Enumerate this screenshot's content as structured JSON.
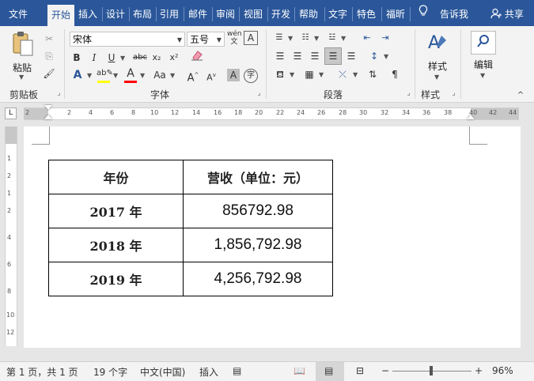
{
  "ribbon_tabs": [
    "文件",
    "开始",
    "插入",
    "设计",
    "布局",
    "引用",
    "邮件",
    "审阅",
    "视图",
    "开发",
    "帮助",
    "文字",
    "特色",
    "福昕",
    "告诉我",
    "共享"
  ],
  "active_tab": "开始",
  "font": {
    "name": "宋体",
    "size": "五号"
  },
  "groups": {
    "clipboard": {
      "label": "剪贴板",
      "paste_label": "粘贴"
    },
    "font": {
      "label": "字体"
    },
    "paragraph": {
      "label": "段落"
    },
    "styles": {
      "label": "样式",
      "button_label": "样式"
    },
    "editing": {
      "label": "编辑",
      "button_label": "编辑"
    }
  },
  "font_buttons": [
    "B",
    "I",
    "U",
    "abc",
    "x₂",
    "x²",
    "Aa"
  ],
  "ruler": {
    "h_numbers": [
      "2",
      "2",
      "4",
      "6",
      "8",
      "10",
      "12",
      "14",
      "16",
      "18",
      "20",
      "22",
      "24",
      "26",
      "28",
      "30",
      "32",
      "34",
      "36",
      "38",
      "40",
      "42",
      "44"
    ],
    "v_numbers": [
      "1",
      "2",
      "1",
      "2",
      "4",
      "6",
      "8",
      "10",
      "12"
    ]
  },
  "table": {
    "headers": [
      "年份",
      "营收（单位：元）"
    ],
    "rows": [
      [
        "2017 年",
        "856792.98"
      ],
      [
        "2018 年",
        "1,856,792.98"
      ],
      [
        "2019 年",
        "4,256,792.98"
      ]
    ]
  },
  "status": {
    "page": "第 1 页，共 1 页",
    "words": "19 个字",
    "language": "中文(中国)",
    "mode": "插入",
    "zoom": "96%",
    "zoom_level": 0.96
  },
  "colors": {
    "ribbon_blue": "#2b579a",
    "highlight": "#ffff00",
    "font_color": "#ff0000"
  }
}
